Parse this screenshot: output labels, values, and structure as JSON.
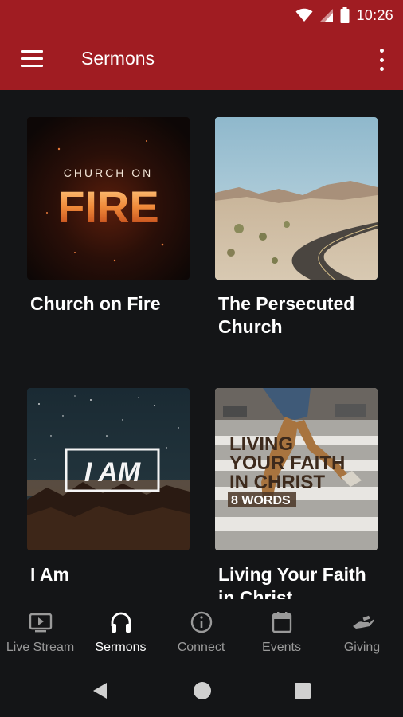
{
  "status": {
    "time": "10:26"
  },
  "appbar": {
    "title": "Sermons"
  },
  "sermons": [
    {
      "title": "Church on Fire",
      "art_top": "CHURCH ON",
      "art_main": "FIRE"
    },
    {
      "title": "The Persecuted Church"
    },
    {
      "title": "I Am",
      "art_main": "I AM"
    },
    {
      "title": "Living Your Faith in Christ",
      "art_line1": "LIVING",
      "art_line2": "YOUR FAITH",
      "art_line3": "IN CHRIST",
      "art_sub": "8 WORDS"
    }
  ],
  "bottom_nav": {
    "items": [
      {
        "label": "Live Stream",
        "icon": "tv-play-icon"
      },
      {
        "label": "Sermons",
        "icon": "headphones-icon",
        "active": true
      },
      {
        "label": "Connect",
        "icon": "info-icon"
      },
      {
        "label": "Events",
        "icon": "calendar-icon"
      },
      {
        "label": "Giving",
        "icon": "hand-giving-icon"
      }
    ]
  },
  "colors": {
    "primary": "#A01C22",
    "background": "#141517",
    "nav_inactive": "#9A9A9A",
    "nav_active": "#FFFFFF"
  }
}
